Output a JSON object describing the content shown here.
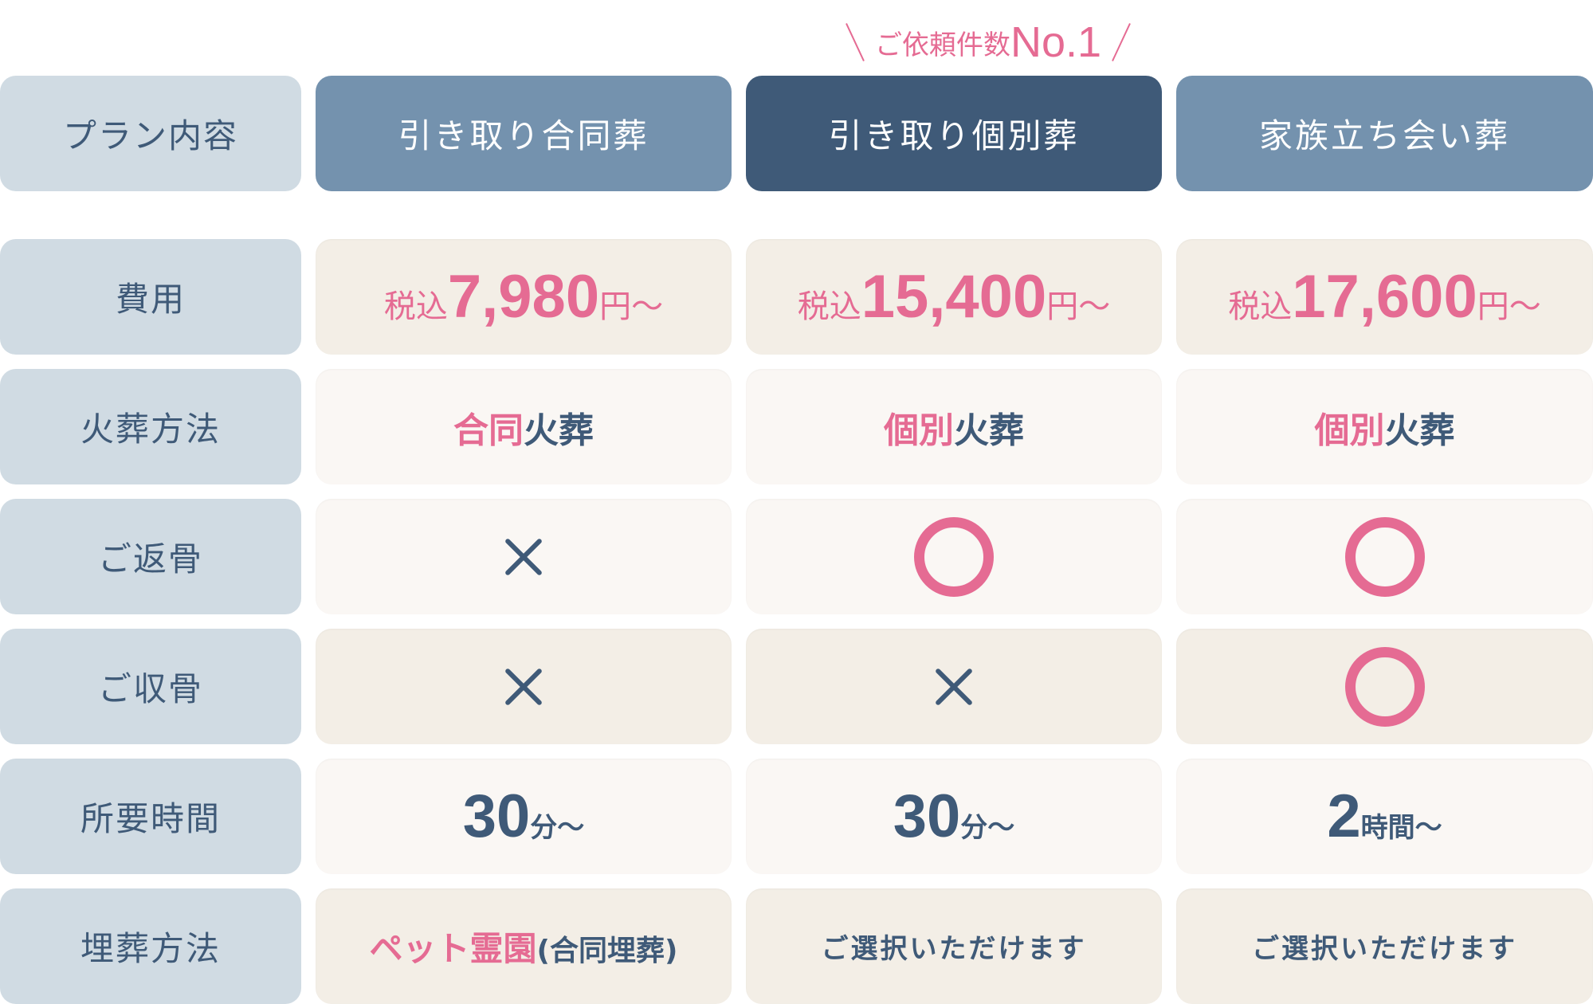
{
  "badge": {
    "text": "ご依頼件数",
    "highlight": "No.1"
  },
  "header": {
    "label": "プラン内容",
    "plans": [
      "引き取り合同葬",
      "引き取り個別葬",
      "家族立ち会い葬"
    ],
    "featured_index": 1
  },
  "rows": {
    "cost": {
      "label": "費用",
      "prefix": "税込",
      "suffix": "円～",
      "values": [
        "7,980",
        "15,400",
        "17,600"
      ]
    },
    "cremation": {
      "label": "火葬方法",
      "values": [
        {
          "highlight": "合同",
          "rest": "火葬"
        },
        {
          "highlight": "個別",
          "rest": "火葬"
        },
        {
          "highlight": "個別",
          "rest": "火葬"
        }
      ]
    },
    "return_ashes": {
      "label": "ご返骨",
      "values": [
        "×",
        "○",
        "○"
      ],
      "icons": [
        "cross-icon",
        "circle-icon",
        "circle-icon"
      ]
    },
    "bone_collection": {
      "label": "ご収骨",
      "values": [
        "×",
        "×",
        "○"
      ],
      "icons": [
        "cross-icon",
        "cross-icon",
        "circle-icon"
      ]
    },
    "duration": {
      "label": "所要時間",
      "values": [
        {
          "num": "30",
          "unit": "分～"
        },
        {
          "num": "30",
          "unit": "分～"
        },
        {
          "num": "2",
          "unit": "時間～"
        }
      ]
    },
    "burial": {
      "label": "埋葬方法",
      "values": [
        {
          "highlight": "ペット霊園",
          "rest": "(合同埋葬)"
        },
        {
          "text": "ご選択いただけます"
        },
        {
          "text": "ご選択いただけます"
        }
      ]
    }
  },
  "colors": {
    "pink": "#e56b93",
    "navy": "#3f5a78",
    "header_light": "#7492ae",
    "label_bg": "#d0dbe3",
    "beige": "#f3eee6",
    "offwhite": "#faf7f4"
  }
}
